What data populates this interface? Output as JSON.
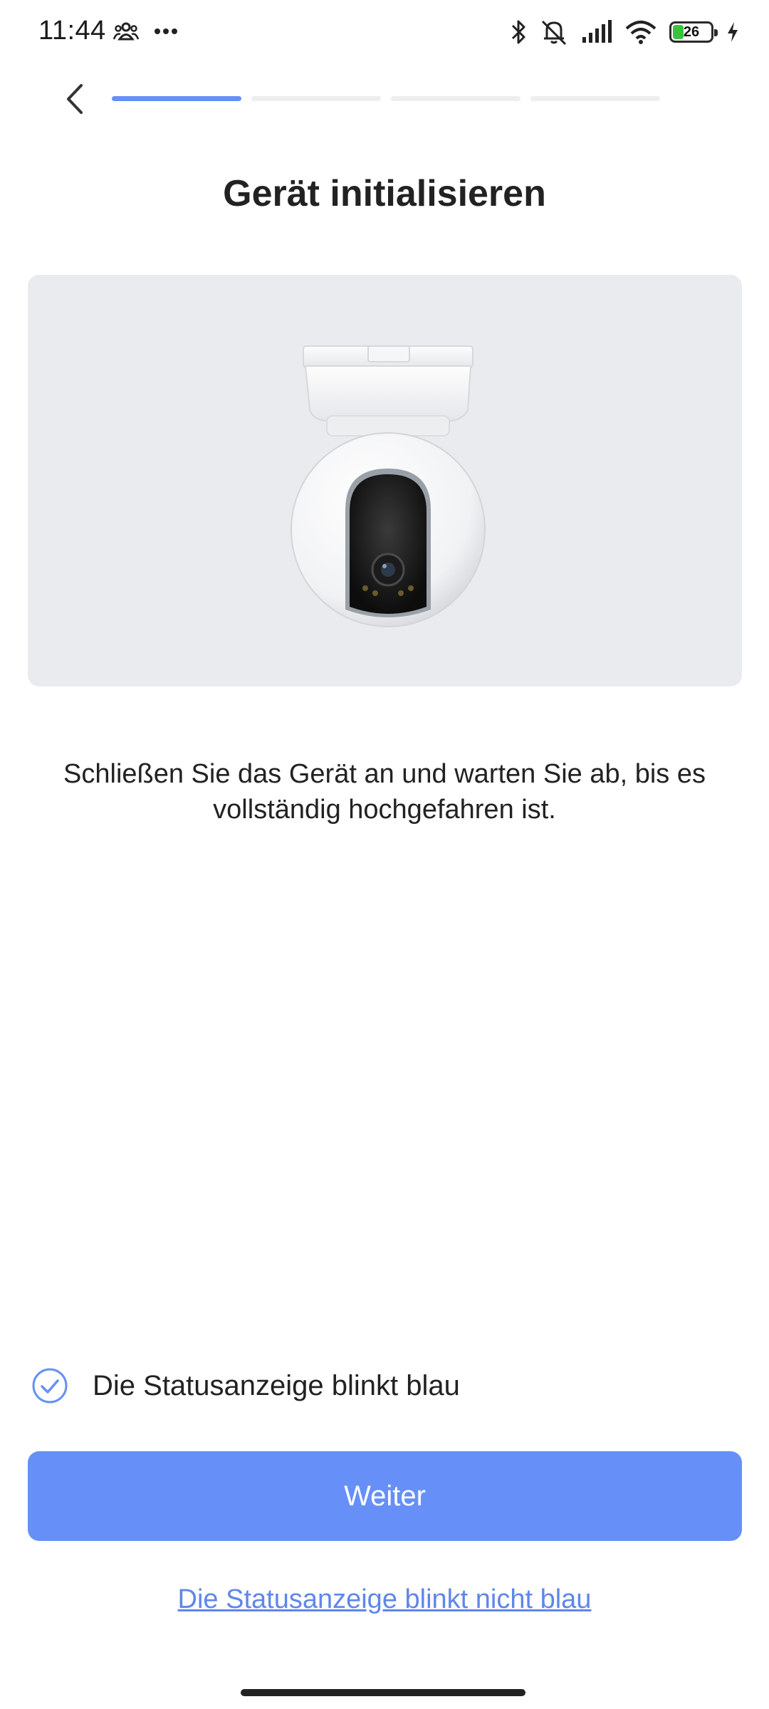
{
  "status_bar": {
    "time": "11:44",
    "battery_level": "26",
    "icons": [
      "people-icon",
      "more-dots-icon",
      "bluetooth-icon",
      "mute-icon",
      "signal-icon",
      "wifi-icon",
      "battery-icon",
      "charging-icon"
    ]
  },
  "nav": {
    "back_icon": "chevron-left-icon",
    "progress_steps": 4,
    "progress_current": 1,
    "accent_color": "#6690f8"
  },
  "page": {
    "title": "Gerät initialisieren",
    "description": "Schließen Sie das Gerät an und warten Sie ab, bis es vollständig hochgefahren ist.",
    "image_icon": "camera-device-image"
  },
  "status_check": {
    "label": "Die Statusanzeige blinkt blau",
    "checked": true
  },
  "actions": {
    "next_label": "Weiter",
    "alt_link_label": "Die Statusanzeige blinkt nicht blau"
  }
}
